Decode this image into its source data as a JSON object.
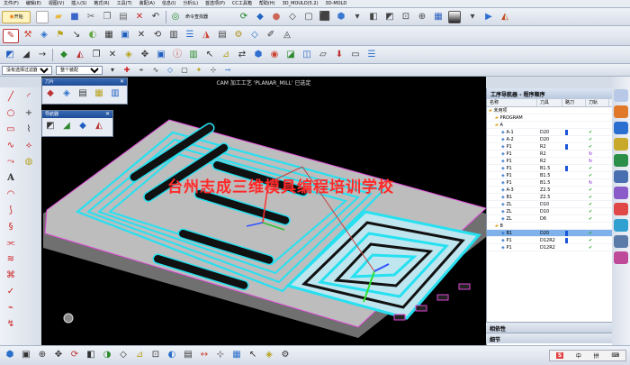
{
  "menu": [
    "文件(F)",
    "编辑(E)",
    "视图(V)",
    "插入(S)",
    "格式(R)",
    "工具(T)",
    "装配(A)",
    "信息(I)",
    "分析(L)",
    "首选项(P)",
    "CC工具箱",
    "帮助(H)",
    "3D_MOULD(5.2)",
    "3D-MOLD"
  ],
  "toolbar": {
    "start_label": "开始",
    "cmd_finder_label": "命令查找器"
  },
  "filters": {
    "selection_filter": "没有选择过滤器",
    "scope": "整个装配"
  },
  "viewport": {
    "title": "CAM 加工工艺 'PLANAR_MILL' 已选定",
    "watermark": "台州志成三维模具编程培训学校"
  },
  "float1": {
    "title": "刀片"
  },
  "float2": {
    "title": "导航器"
  },
  "navigator": {
    "title": "工序导航器 - 程序顺序",
    "columns": [
      "名称",
      "刀具",
      "路刀",
      "刀轨"
    ],
    "rows": [
      {
        "name": "未用项",
        "tool": "",
        "path": "",
        "status": "",
        "indent": 0
      },
      {
        "name": "PROGRAM",
        "tool": "",
        "path": "",
        "status": "",
        "indent": 1
      },
      {
        "name": "A",
        "tool": "",
        "path": "",
        "status": "",
        "indent": 1
      },
      {
        "name": "A-1",
        "tool": "D20",
        "path": "bar",
        "status": "ok",
        "indent": 2
      },
      {
        "name": "A-2",
        "tool": "D20",
        "path": "",
        "status": "ok",
        "indent": 2
      },
      {
        "name": "P1",
        "tool": "R2",
        "path": "bar",
        "status": "ok",
        "indent": 2
      },
      {
        "name": "P1",
        "tool": "R2",
        "path": "",
        "status": "re",
        "indent": 2
      },
      {
        "name": "P1",
        "tool": "R2",
        "path": "",
        "status": "re",
        "indent": 2
      },
      {
        "name": "P1",
        "tool": "B1.5",
        "path": "bar",
        "status": "ok",
        "indent": 2
      },
      {
        "name": "P1",
        "tool": "B1.5",
        "path": "",
        "status": "ok",
        "indent": 2
      },
      {
        "name": "P1",
        "tool": "B1.5",
        "path": "",
        "status": "re",
        "indent": 2
      },
      {
        "name": "A-3",
        "tool": "Z2.5",
        "path": "",
        "status": "ok",
        "indent": 2
      },
      {
        "name": "B1",
        "tool": "Z2.5",
        "path": "",
        "status": "ok",
        "indent": 2
      },
      {
        "name": "ZL",
        "tool": "D10",
        "path": "",
        "status": "ok",
        "indent": 2
      },
      {
        "name": "ZL",
        "tool": "D10",
        "path": "",
        "status": "ok",
        "indent": 2
      },
      {
        "name": "ZL",
        "tool": "D6",
        "path": "",
        "status": "ok",
        "indent": 2
      },
      {
        "name": "B",
        "tool": "",
        "path": "",
        "status": "",
        "indent": 1
      },
      {
        "name": "B1",
        "tool": "D20",
        "path": "bar",
        "status": "ok",
        "indent": 2,
        "selected": true
      },
      {
        "name": "P1",
        "tool": "D12R2",
        "path": "bar",
        "status": "ok",
        "indent": 2
      },
      {
        "name": "P1",
        "tool": "D12R2",
        "path": "",
        "status": "ok",
        "indent": 2
      }
    ],
    "dependencies_label": "相依性",
    "details_label": "细节"
  },
  "status_icons": [
    "S",
    "中",
    "拼"
  ],
  "colors": {
    "toolpath": "#27e0f0",
    "stock": "#c8c8c8",
    "watermark": "#ff2a2a",
    "selected_row": "#7fb2ea"
  }
}
